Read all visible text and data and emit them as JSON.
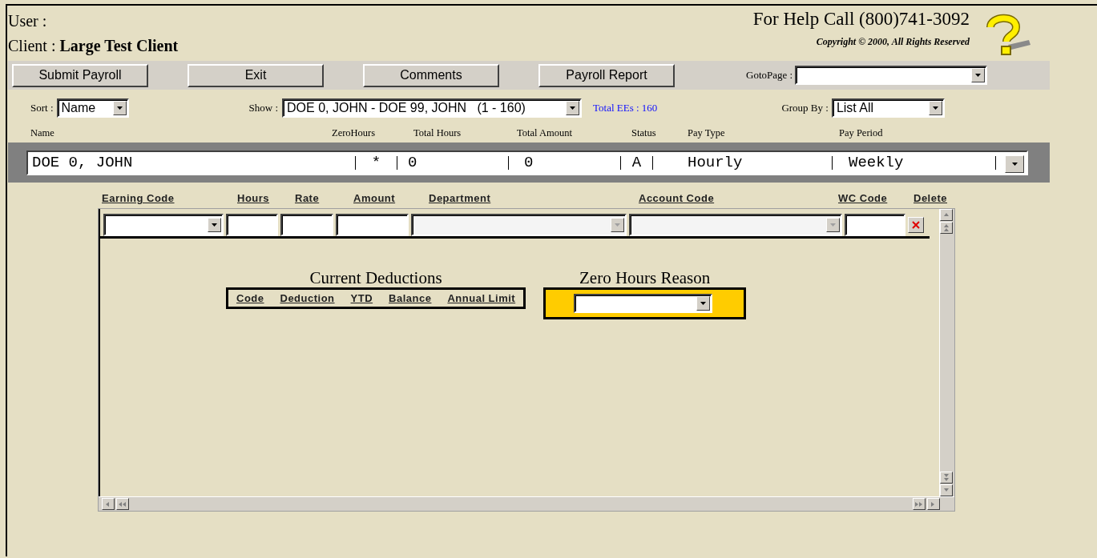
{
  "user": {
    "label": "User :"
  },
  "client": {
    "label": "Client :",
    "name": "Large Test Client"
  },
  "help": {
    "text": "For Help Call (800)741-3092",
    "copyright": "Copyright © 2000, All Rights Reserved"
  },
  "buttons": [
    "Submit Payroll",
    "Exit",
    "Comments",
    "Payroll Report"
  ],
  "goto_page": {
    "label": "GotoPage :"
  },
  "sort": {
    "label": "Sort :",
    "value": "Name"
  },
  "show": {
    "label": "Show :",
    "value": "DOE 0, JOHN - DOE 99, JOHN   (1 - 160)"
  },
  "total_ees": "Total EEs : 160",
  "group_by": {
    "label": "Group By :",
    "value": "List All"
  },
  "employee_columns": [
    {
      "label": "Name",
      "value": "DOE 0, JOHN"
    },
    {
      "label": "ZeroHours",
      "value": "*"
    },
    {
      "label": "Total Hours",
      "value": "0"
    },
    {
      "label": "Total Amount",
      "value": "0"
    },
    {
      "label": "Status",
      "value": "A"
    },
    {
      "label": "Pay Type",
      "value": "Hourly"
    },
    {
      "label": "Pay Period",
      "value": "Weekly"
    }
  ],
  "earning_columns": [
    {
      "label": "Earning Code",
      "kind": "select",
      "disabled": false
    },
    {
      "label": "Hours",
      "kind": "text",
      "disabled": false
    },
    {
      "label": "Rate",
      "kind": "text",
      "disabled": false
    },
    {
      "label": "Amount",
      "kind": "text",
      "disabled": false
    },
    {
      "label": "Department",
      "kind": "select",
      "disabled": true
    },
    {
      "label": "Account Code",
      "kind": "select",
      "disabled": true
    },
    {
      "label": "WC Code",
      "kind": "text",
      "disabled": false
    },
    {
      "label": "Delete",
      "kind": "delete",
      "disabled": false
    }
  ],
  "deductions": {
    "title": "Current Deductions",
    "columns": [
      "Code",
      "Deduction",
      "YTD",
      "Balance",
      "Annual Limit"
    ]
  },
  "zero_hours_reason": {
    "title": "Zero Hours Reason"
  }
}
